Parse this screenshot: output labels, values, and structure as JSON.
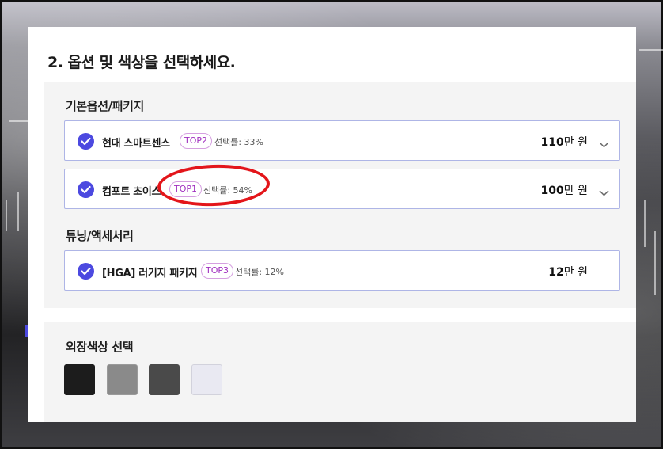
{
  "heading": "2. 옵션 및 색상을 선택하세요.",
  "sections": {
    "basic_title": "기본옵션/패키지",
    "tuning_title": "튜닝/액세서리",
    "color_title": "외장색상 선택"
  },
  "options": [
    {
      "name": "현대 스마트센스",
      "badge": "TOP2",
      "rate": "선택률: 33%",
      "price_num": "110",
      "price_unit": "만 원",
      "expandable": true
    },
    {
      "name": "컴포트 초이스",
      "badge": "TOP1",
      "rate": "선택률: 54%",
      "price_num": "100",
      "price_unit": "만 원",
      "expandable": true
    },
    {
      "name": "[HGA] 러기지 패키지",
      "badge": "TOP3",
      "rate": "선택률: 12%",
      "price_num": "12",
      "price_unit": "만 원",
      "expandable": false
    }
  ],
  "colors": {
    "accent": "#4c49e0",
    "badge": "#a02fbf",
    "highlight_circle": "#e3151a",
    "swatches": [
      "#1c1c1c",
      "#8a8a8a",
      "#4a4a4a",
      "#e9e9f2"
    ]
  },
  "icons": [
    "check-icon",
    "chevron-down-icon"
  ]
}
